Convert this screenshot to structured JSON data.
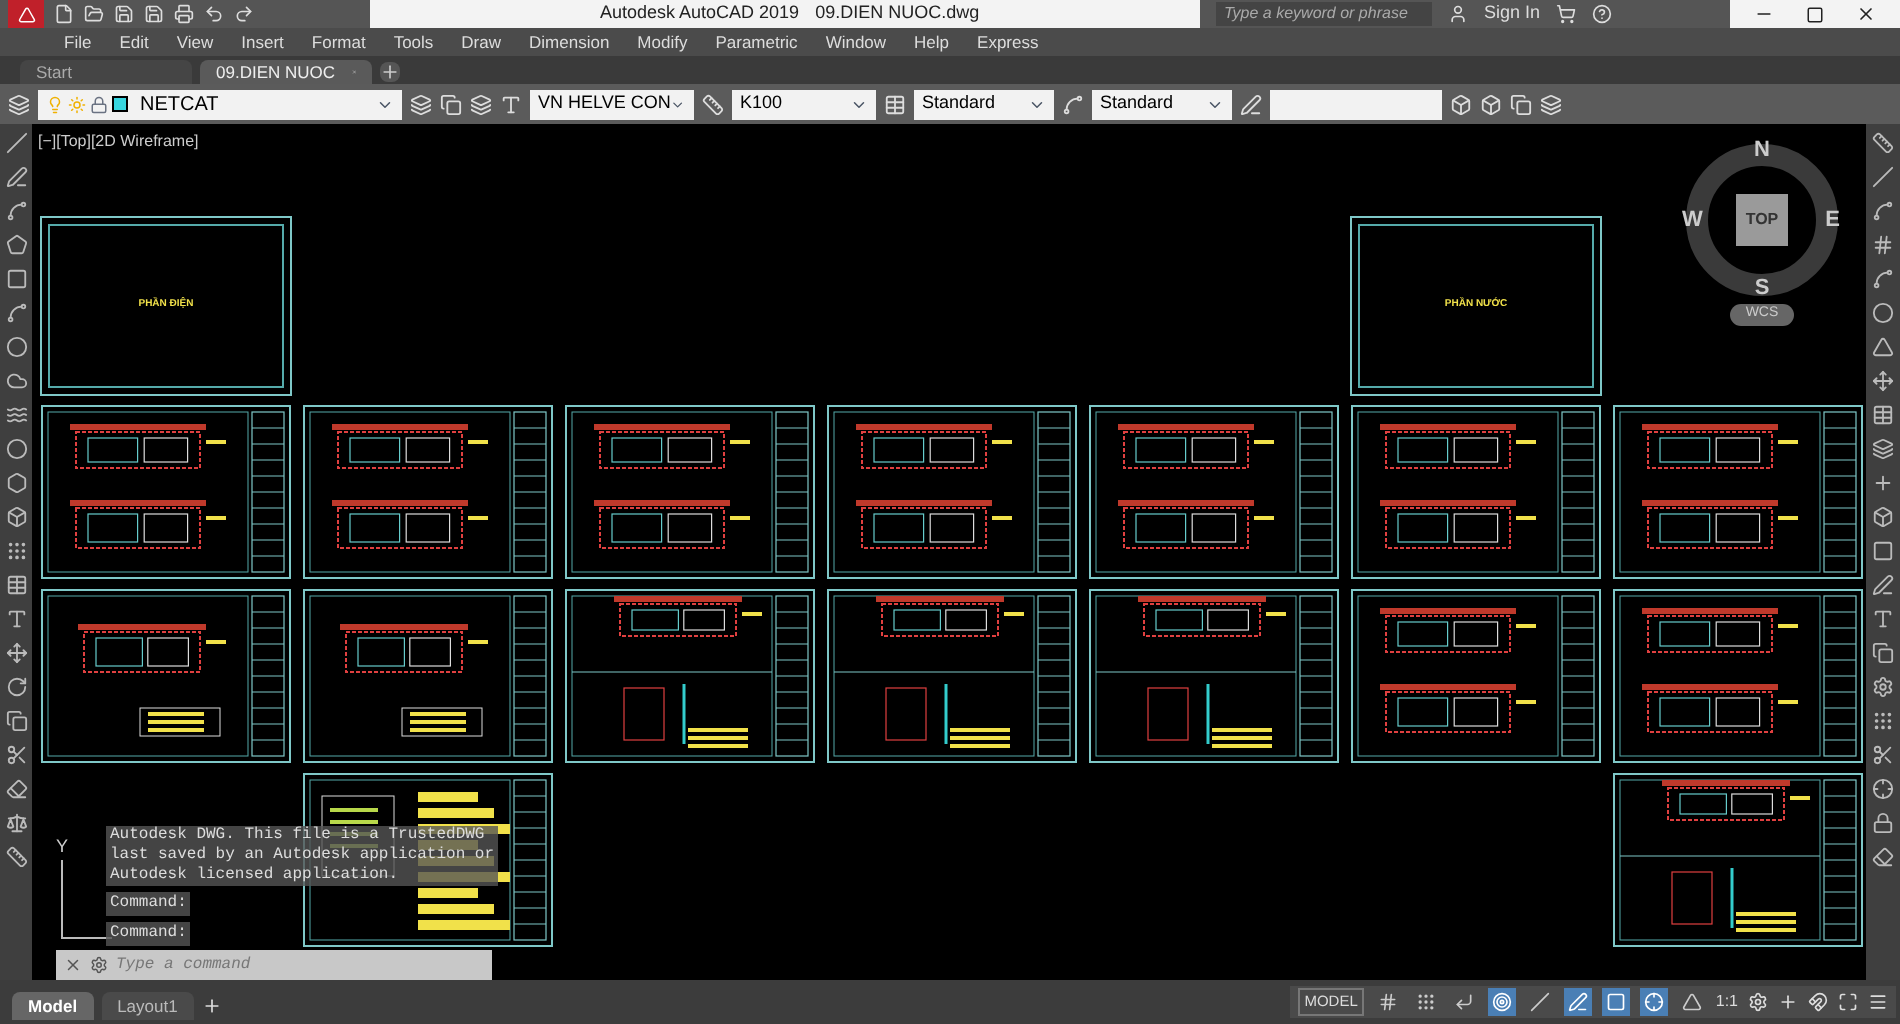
{
  "window": {
    "title": "Autodesk AutoCAD 2019",
    "file": "09.DIEN NUOC.dwg"
  },
  "search": {
    "placeholder": "Type a keyword or phrase"
  },
  "account": {
    "label": "Sign In"
  },
  "menu": [
    "File",
    "Edit",
    "View",
    "Insert",
    "Format",
    "Tools",
    "Draw",
    "Dimension",
    "Modify",
    "Parametric",
    "Window",
    "Help",
    "Express"
  ],
  "doc_tabs": [
    {
      "label": "Start",
      "selected": false
    },
    {
      "label": "09.DIEN NUOC",
      "selected": true
    }
  ],
  "toolbar": {
    "layer": "NETCAT",
    "text_style": "VN HELVE CON",
    "dim_style": "K100",
    "table_style": "Standard",
    "multileader_style": "Standard"
  },
  "viewport": {
    "label": "[−][Top][2D Wireframe]"
  },
  "viewcube": {
    "face": "TOP",
    "north": "N",
    "south": "S",
    "east": "E",
    "west": "W",
    "ucs": "WCS"
  },
  "sheet_rows": [
    [
      {
        "kind": "title",
        "label": "PHẦN ĐIỆN"
      },
      {
        "kind": "empty"
      },
      {
        "kind": "empty"
      },
      {
        "kind": "empty"
      },
      {
        "kind": "empty"
      },
      {
        "kind": "title",
        "label": "PHẦN NƯỚC"
      },
      {
        "kind": "empty"
      }
    ],
    [
      {
        "kind": "plan"
      },
      {
        "kind": "plan"
      },
      {
        "kind": "plan"
      },
      {
        "kind": "plan"
      },
      {
        "kind": "plan"
      },
      {
        "kind": "plan"
      },
      {
        "kind": "plan"
      }
    ],
    [
      {
        "kind": "single"
      },
      {
        "kind": "single"
      },
      {
        "kind": "section"
      },
      {
        "kind": "section"
      },
      {
        "kind": "section"
      },
      {
        "kind": "plan"
      },
      {
        "kind": "plan"
      }
    ],
    [
      {
        "kind": "empty"
      },
      {
        "kind": "notes"
      },
      {
        "kind": "empty"
      },
      {
        "kind": "empty"
      },
      {
        "kind": "empty"
      },
      {
        "kind": "empty"
      },
      {
        "kind": "section"
      }
    ]
  ],
  "ucs_label": "Y",
  "command_history": [
    "Autodesk DWG.  This file is a TrustedDWG",
    "last saved by an Autodesk application or",
    "Autodesk licensed application.",
    "Command:",
    "Command:"
  ],
  "command_line": {
    "placeholder": "Type a command"
  },
  "layout_tabs": [
    {
      "label": "Model",
      "selected": true
    },
    {
      "label": "Layout1",
      "selected": false
    }
  ],
  "status_bar": {
    "space": "MODEL",
    "scale": "1:1",
    "toggles": [
      {
        "kind": "grid",
        "on": false
      },
      {
        "kind": "snap",
        "on": false
      },
      {
        "kind": "ortho",
        "on": false
      },
      {
        "kind": "polar",
        "on": true
      },
      {
        "kind": "isometric",
        "on": false
      },
      {
        "kind": "tracking",
        "on": true
      },
      {
        "kind": "osnap",
        "on": true
      },
      {
        "kind": "annotation",
        "on": true
      },
      {
        "kind": "autoscale",
        "on": false
      }
    ]
  }
}
